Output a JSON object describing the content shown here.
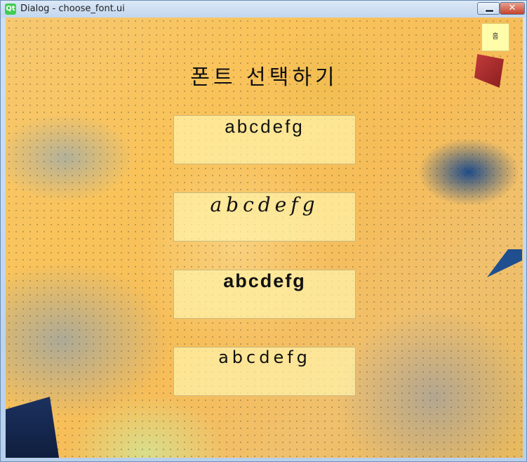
{
  "window": {
    "app_icon": "Qt",
    "title": "Dialog - choose_font.ui"
  },
  "dialog": {
    "heading": "폰트 선택하기",
    "font_buttons": [
      {
        "label": "abcdefg"
      },
      {
        "label": "abcdefg"
      },
      {
        "label": "abcdefg"
      },
      {
        "label": "abcdefg"
      }
    ],
    "home_button_label": "홈"
  },
  "colors": {
    "button_bg": "#fff4aa",
    "home_button_bg": "#fffcaa",
    "background_accent": "#f6c870"
  }
}
